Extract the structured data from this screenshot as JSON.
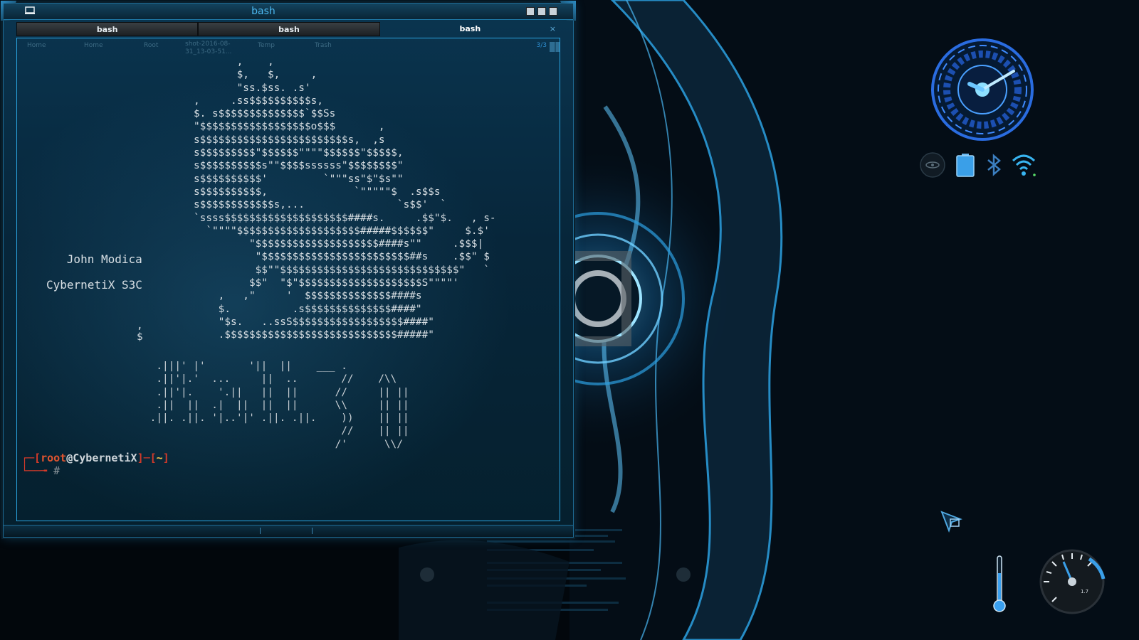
{
  "window": {
    "title": "bash"
  },
  "tabs": [
    {
      "label": "bash",
      "active": false
    },
    {
      "label": "bash",
      "active": false
    },
    {
      "label": "bash",
      "active": true
    }
  ],
  "desktop_icons": [
    "Home",
    "Home",
    "Root",
    "shot-2016-08-31_13-03-51...",
    "Temp",
    "Trash"
  ],
  "workspace_indicator": "3/3",
  "ascii_art": "       ,    ,\n       $,   $,     ,\n       \"ss.$ss. .s'\n,     .ss$$$$$$$$$$s,\n$. s$$$$$$$$$$$$$$`$$Ss\n\"$$$$$$$$$$$$$$$$$$o$$$       ,\ns$$$$$$$$$$$$$$$$$$$$$$$$s,  ,s\ns$$$$$$$$$\"$$$$$$\"\"\"\"$$$$$$\"$$$$$,\ns$$$$$$$$$$s\"\"$$$$ssssss\"$$$$$$$$\"\ns$$$$$$$$$$'         `\"\"\"ss\"$\"$s\"\"\ns$$$$$$$$$$,              `\"\"\"\"\"$  .s$$s\ns$$$$$$$$$$$$s,...               `s$$'  `\n`ssss$$$$$$$$$$$$$$$$$$$$####s.     .$$\"$.   , s-\n  `\"\"\"\"$$$$$$$$$$$$$$$$$$$$#####$$$$$$\"     $.$'\n         \"$$$$$$$$$$$$$$$$$$$$####s\"\"     .$$$|\n          \"$$$$$$$$$$$$$$$$$$$$$$$$##s    .$$\" $\n          $$\"\"$$$$$$$$$$$$$$$$$$$$$$$$$$$$$\"   `\n         $$\"  \"$\"$$$$$$$$$$$$$$$$$$$$S\"\"\"\"'\n    ,   ,\"     '  $$$$$$$$$$$$$$####s\n    $.          .s$$$$$$$$$$$$$$####\"\n    \"$s.   ..ssS$$$$$$$$$$$$$$$$$$####\"\n    .$$$$$$$$$$$$$$$$$$$$$$$$$$$$#####\"",
  "ascii_art_side": [
    ",",
    "$"
  ],
  "kali_logo": "  .|||' |'       '||  ||    ___ .\n  .||'|.'  ...     ||  ..       //    /\\\\\n  .||'|.    '.||   ||  ||      //     || ||\n  .||  ||  .|  ||  ||  ||      \\\\     || ||\n .||. .||. '|..'|' .||. .||.    ))    || ||\n                                //    || ||\n                               /'      \\\\/",
  "author": {
    "line1": "John Modica",
    "line2": "CybernetiX S3C"
  },
  "prompt": {
    "user": "root",
    "at": "@",
    "host": "CybernetiX",
    "dir": "~",
    "symbol": "#"
  },
  "widgets": {
    "gauge_label": "1.7"
  },
  "colors": {
    "accent": "#2aa4e0",
    "prompt_red": "#d33a2a",
    "dir_yellow": "#f0c04a",
    "bluetooth": "#3c7fc0",
    "wifi": "#38b4f0"
  },
  "icons": [
    "window-menu-icon",
    "minimize-icon",
    "maximize-icon",
    "close-icon",
    "clock-icon",
    "eye-icon",
    "battery-icon",
    "bluetooth-icon",
    "wifi-icon",
    "cursor-icon",
    "thermometer-icon",
    "gauge-icon"
  ]
}
